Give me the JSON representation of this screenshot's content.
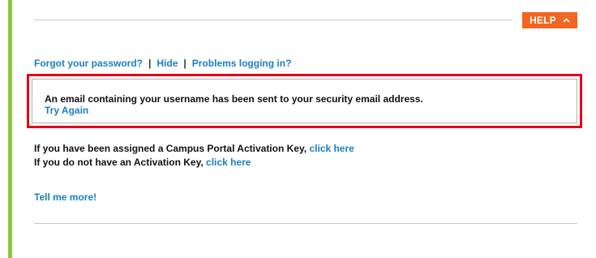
{
  "help": {
    "label": "HELP",
    "icon": "chevron-up-icon",
    "color": "#f26522"
  },
  "links": {
    "forgot_password": "Forgot your password?",
    "separator": "|",
    "hide": "Hide",
    "problems": "Problems logging in?"
  },
  "alert": {
    "message": "An email containing your username has been sent to your security email address.",
    "retry": "Try Again",
    "border_color": "#e1001b"
  },
  "activation": {
    "assigned_text": "If you have been assigned a Campus Portal Activation Key,",
    "assigned_link": "click here",
    "no_key_text": "If you do not have an Activation Key,",
    "no_key_link": "click here"
  },
  "tell_more": "Tell me more!",
  "colors": {
    "link": "#1a7fc1",
    "accent_bar": "#8dc63f"
  }
}
